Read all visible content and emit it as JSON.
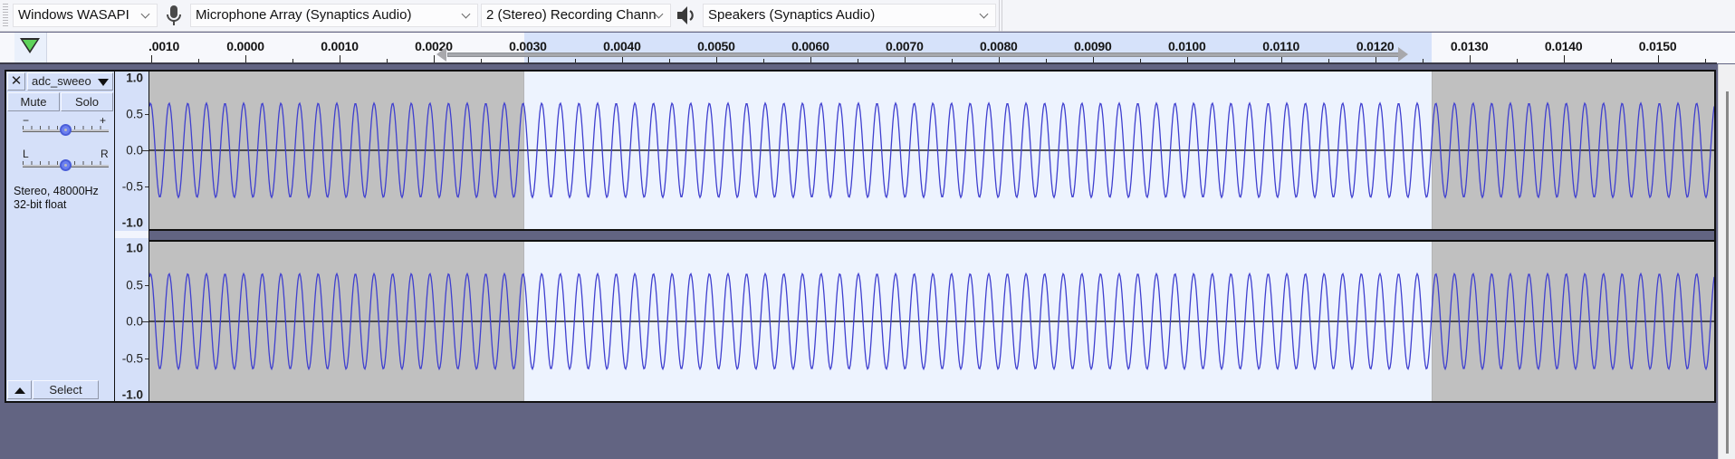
{
  "device_toolbar": {
    "host": "Windows WASAPI",
    "recording_device": "Microphone Array (Synaptics Audio)",
    "recording_channels": "2 (Stereo) Recording Chann",
    "playback_device": "Speakers (Synaptics Audio)",
    "icons": {
      "mic": "microphone-icon",
      "speaker": "speaker-icon"
    }
  },
  "ruler": {
    "unit": "seconds",
    "labels": [
      ".0010",
      "0.0000",
      "0.0010",
      "0.0020",
      "0.0030",
      "0.0040",
      "0.0050",
      "0.0060",
      "0.0070",
      "0.0080",
      "0.0090",
      "0.0100",
      "0.0110",
      "0.0120",
      "0.0130",
      "0.0140",
      "0.0150"
    ],
    "label_values": [
      -0.001,
      0.0,
      0.001,
      0.002,
      0.003,
      0.004,
      0.005,
      0.006,
      0.007,
      0.008,
      0.009,
      0.01,
      0.011,
      0.012,
      0.013,
      0.014,
      0.015
    ],
    "view_start": -0.00102,
    "view_end": 0.0156,
    "selection_start": 0.00296,
    "selection_end": 0.0126,
    "play_head_icon": "play-head-triangle-icon"
  },
  "track": {
    "close_label": "✕",
    "name": "adc_sweeo",
    "mute_label": "Mute",
    "solo_label": "Solo",
    "gain": {
      "minus": "−",
      "plus": "+",
      "value": 0.5
    },
    "pan": {
      "left": "L",
      "right": "R",
      "value": 0.5
    },
    "info_line1": "Stereo, 48000Hz",
    "info_line2": "32-bit float",
    "select_label": "Select",
    "collapse_icon": "collapse-up-icon",
    "vertical_scale": {
      "labels": [
        "1.0",
        "0.5",
        "0.0",
        "-0.5",
        "-1.0"
      ],
      "values": [
        1.0,
        0.5,
        0.0,
        -0.5,
        -1.0
      ]
    },
    "waveform": {
      "amplitude": 0.65,
      "cycles_visible": 84,
      "color": "#3f3fcf",
      "channels": [
        "left",
        "right"
      ]
    }
  },
  "colors": {
    "selection_bg": "#edf3fe",
    "unselected_bg": "#c0c0c0",
    "ruler_selection": "#d6e2fa",
    "background": "#626482"
  }
}
